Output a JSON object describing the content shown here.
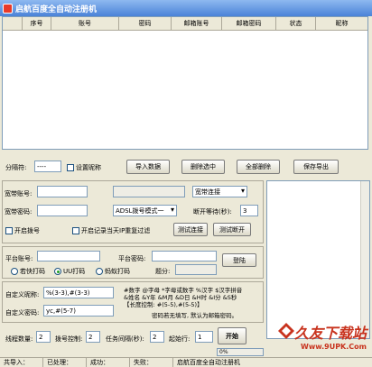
{
  "window": {
    "title": "启航百度全自动注册机"
  },
  "grid": {
    "columns": [
      "",
      "序号",
      "账号",
      "密码",
      "邮箱账号",
      "邮箱密码",
      "状态",
      "昵称"
    ]
  },
  "toolbar": {
    "separator_label": "分隔符:",
    "separator_value": "----",
    "set_nickname": "设置昵称",
    "import": "导入数据",
    "delete_selected": "删除选中",
    "delete_all": "全部删除",
    "save_export": "保存导出"
  },
  "broadband": {
    "account_label": "宽带账号:",
    "account_value": "",
    "password_label": "宽带密码:",
    "password_value": "",
    "connect_select": "宽带连接",
    "mode_select": "ADSL拨号模式一",
    "wait_label": "断开等待(秒):",
    "wait_value": "3",
    "enable_dial": "开启拨号",
    "record_ip": "开启记录当天IP重复过滤",
    "test_connect": "测试连接",
    "test_disconnect": "测试断开"
  },
  "platform": {
    "account_label": "平台账号:",
    "password_label": "平台密码:",
    "login": "登陆",
    "options": [
      "若快打码",
      "UU打码",
      "蚂蚁打码"
    ],
    "selected": 1,
    "score_label": "题分:"
  },
  "custom": {
    "nickname_label": "自定义昵称:",
    "nickname_value": "%(3-3),#(3-3)",
    "password_label": "自定义密码:",
    "password_value": "yc,#(5-7)",
    "help_line1": "#数字 @字母 *字母或数字 %汉字 $汉字拼音",
    "help_line2": "&姓名 &Y年 &M月 &D日 &H时 &I分 &S秒",
    "help_line3": "【长度控制: #(5-5),#(5-5)】",
    "help_line4": "密码若无填写, 默认为邮箱密码。"
  },
  "threads": {
    "count_label": "线程数量:",
    "count_value": "2",
    "dial_label": "拨号控制:",
    "dial_value": "2",
    "interval_label": "任务间隔(秒):",
    "interval_value": "2",
    "start_label": "起始行:",
    "start_value": "1",
    "start_button": "开始"
  },
  "progress": {
    "value": "0%"
  },
  "status": {
    "items": [
      "共导入：",
      "已处理：",
      "成功：",
      "失败：",
      "启航百度全自动注册机"
    ]
  },
  "watermark": {
    "brand": "久友下载站",
    "url": "Www.9UPK.Com"
  },
  "colors": {
    "title_top": "#8eb8f0",
    "title_bottom": "#4a82d8",
    "watermark": "#c8331e"
  }
}
